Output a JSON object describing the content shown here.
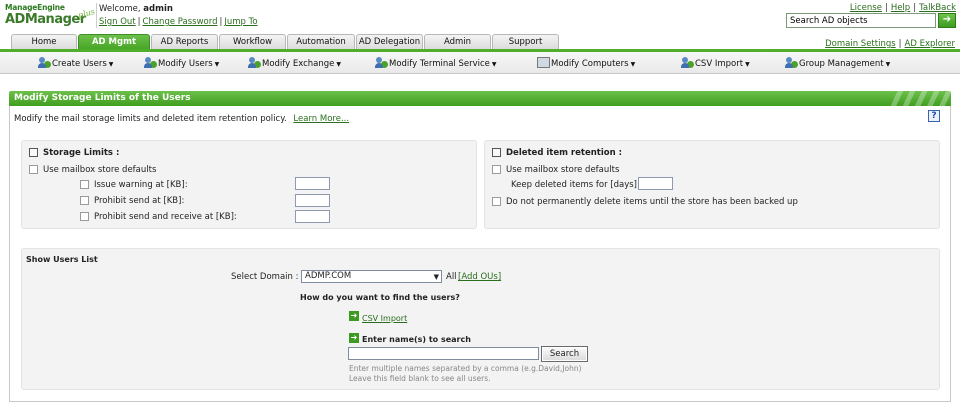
{
  "header": {
    "logo_line1": "ManageEngine",
    "logo_line2": "ADManager",
    "logo_plus": "plus",
    "welcome_prefix": "Welcome,",
    "username": "admin",
    "sign_out": "Sign Out",
    "change_password": "Change Password",
    "jump_to": "Jump To",
    "link_separator": "|",
    "top_links": [
      "License",
      "Help",
      "TalkBack"
    ],
    "search_placeholder": "Search AD objects",
    "search_go": "➔"
  },
  "tabs": [
    {
      "label": "Home"
    },
    {
      "label": "AD Mgmt",
      "active": true
    },
    {
      "label": "AD Reports"
    },
    {
      "label": "Workflow"
    },
    {
      "label": "Automation"
    },
    {
      "label": "AD Delegation"
    },
    {
      "label": "Admin"
    },
    {
      "label": "Support"
    }
  ],
  "right_links": [
    "Domain Settings",
    "AD Explorer"
  ],
  "submenu": [
    {
      "label": "Create Users",
      "icon": "user-icon"
    },
    {
      "label": "Modify Users",
      "icon": "user-icon"
    },
    {
      "label": "Modify Exchange",
      "icon": "user-icon"
    },
    {
      "label": "Modify Terminal Service",
      "icon": "user-icon"
    },
    {
      "label": "Modify Computers",
      "icon": "computer-icon"
    },
    {
      "label": "CSV Import",
      "icon": "csv-icon"
    },
    {
      "label": "Group Management",
      "icon": "group-icon"
    }
  ],
  "panel": {
    "title": "Modify Storage Limits of the Users",
    "description": "Modify the mail storage limits and deleted item retention policy.",
    "learn_more": "Learn More...",
    "help": "?"
  },
  "storage": {
    "title": "Storage Limits :",
    "use_defaults": "Use mailbox store defaults",
    "issue_warning": "Issue warning at [KB]:",
    "prohibit_send": "Prohibit send at [KB]:",
    "prohibit_send_receive": "Prohibit send and receive at [KB]:"
  },
  "retention": {
    "title": "Deleted item retention :",
    "use_defaults": "Use mailbox store defaults",
    "keep_days": "Keep deleted items for [days]:",
    "no_delete": "Do not permanently delete items until the store has been backed up"
  },
  "users": {
    "title": "Show Users List",
    "select_domain_label": "Select Domain :",
    "domain": "ADMP.COM",
    "all": "All",
    "add_ous": "[Add OUs]",
    "find_question": "How do you want to find the users?",
    "csv_import": "CSV Import",
    "enter_names": "Enter name(s) to search",
    "search_button": "Search",
    "hint1": "Enter multiple names separated by a comma (e.g.David,John)",
    "hint2": "Leave this field blank to see all users."
  }
}
